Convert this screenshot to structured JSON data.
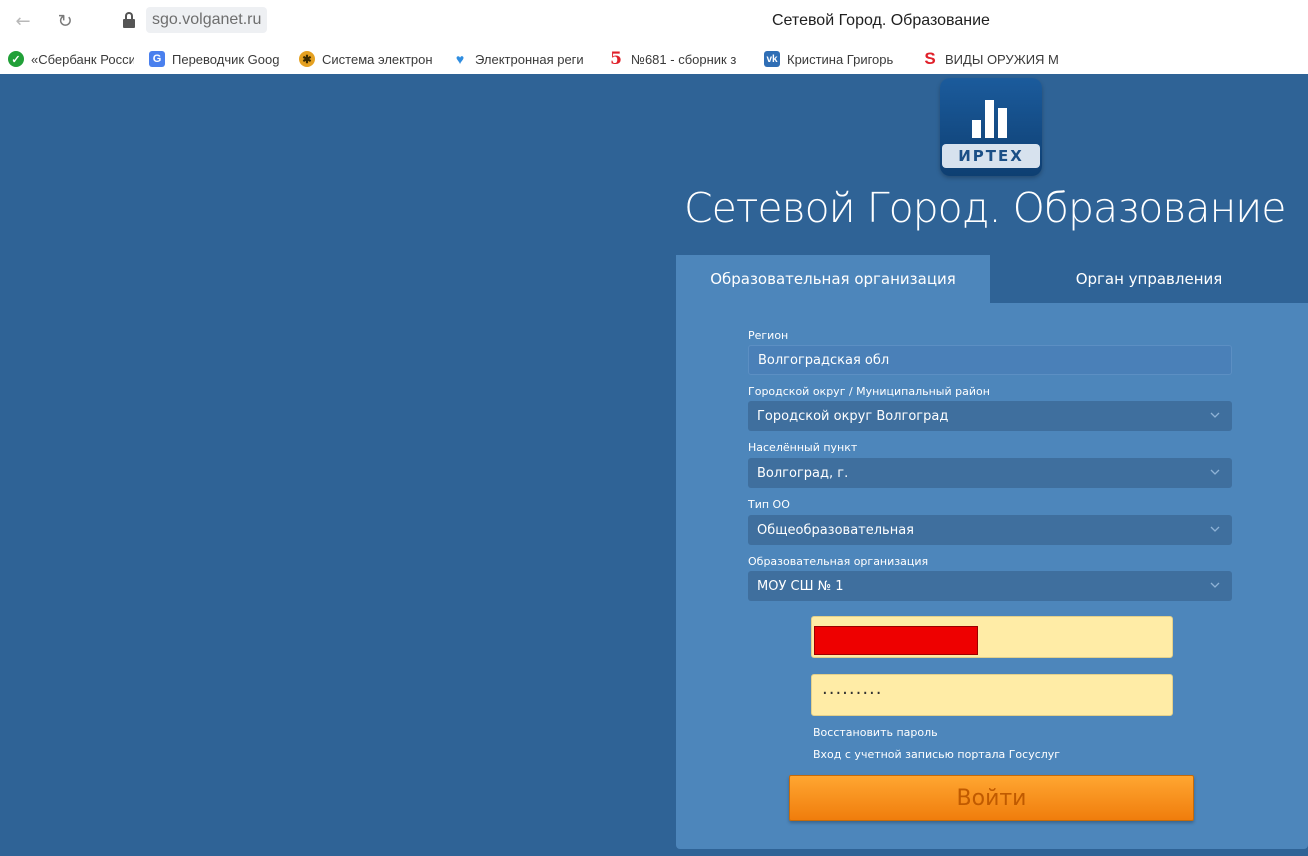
{
  "browser": {
    "url": "sgo.volganet.ru",
    "window_title": "Сетевой Город. Образование"
  },
  "bookmarks": [
    {
      "label": "«Сбербанк Росси",
      "icon": "sberbank-icon"
    },
    {
      "label": "Переводчик Goog",
      "icon": "google-translate-icon"
    },
    {
      "label": "Система электрон",
      "icon": "system-icon"
    },
    {
      "label": "Электронная реги",
      "icon": "heart-icon"
    },
    {
      "label": "№681 - сборник з",
      "icon": "five-icon"
    },
    {
      "label": "Кристина Григорь",
      "icon": "vk-icon"
    },
    {
      "label": "ВИДЫ ОРУЖИЯ М",
      "icon": "s-icon"
    }
  ],
  "logo": {
    "plate_text": "ИРТЕХ"
  },
  "site_title": "Сетевой Город. Образование",
  "tabs": {
    "active": "Образовательная организация",
    "inactive": "Орган управления"
  },
  "form": {
    "region": {
      "label": "Регион",
      "value": "Волгоградская обл"
    },
    "district": {
      "label": "Городской округ / Муниципальный район",
      "value": "Городской округ Волгоград"
    },
    "locality": {
      "label": "Населённый пункт",
      "value": "Волгоград, г."
    },
    "org_type": {
      "label": "Тип ОО",
      "value": "Общеобразовательная"
    },
    "organization": {
      "label": "Образовательная организация",
      "value": "МОУ СШ № 1"
    },
    "password_mask": "·········",
    "restore_link": "Восстановить пароль",
    "gosuslugi_link": "Вход с учетной записью портала Госуслуг",
    "login_button": "Войти"
  },
  "colors": {
    "page_bg": "#2f6396",
    "panel_bg": "#4d86bb",
    "input_yellow": "#ffeca6",
    "button_orange": "#f07d0c",
    "redaction": "#ee0000"
  }
}
